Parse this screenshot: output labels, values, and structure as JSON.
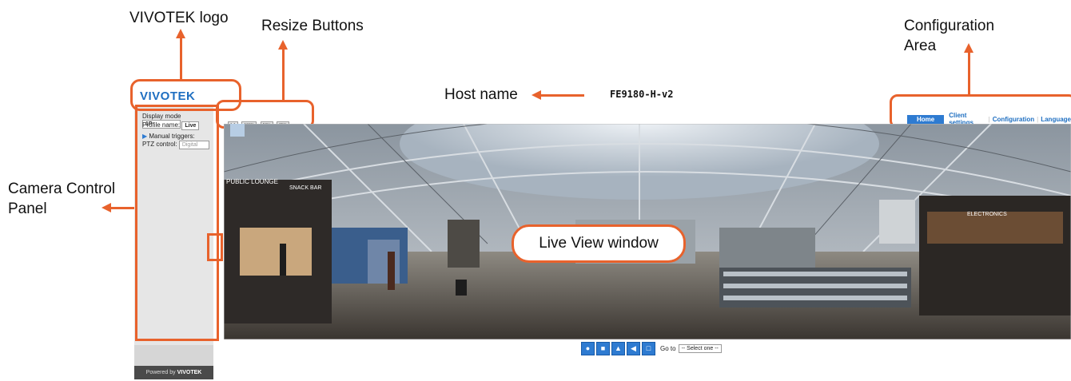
{
  "callouts": {
    "logo": "VIVOTEK logo",
    "resize": "Resize Buttons",
    "host": "Host name",
    "config_line1": "Configuration",
    "config_line2": "Area",
    "panel_line1": "Camera Control",
    "panel_line2": "Panel",
    "live": "Live View window"
  },
  "brand": {
    "logo": "VIVOTEK",
    "powered": "Powered by",
    "powered_brand": "VIVOTEK"
  },
  "host_name": "FE9180-H-v2",
  "nav": {
    "home": "Home",
    "client": "Client settings",
    "config": "Configuration",
    "language": "Language"
  },
  "panel": {
    "display_mode_label": "Display mode",
    "display_mode_value": "1P",
    "profile_label": "Profile name:",
    "profile_value": "Live",
    "manual_triggers": "Manual triggers:",
    "ptz_label": "PTZ control:",
    "ptz_value": "Digital"
  },
  "resize_buttons": [
    "1:1",
    "100%",
    "50%",
    "25%"
  ],
  "scene_signs": {
    "lounge": "PUBLIC LOUNGE",
    "snack": "SNACK BAR",
    "electronics": "ELECTRONICS"
  },
  "bottom_bar": {
    "goto_label": "Go to",
    "goto_value": "-- Select one --"
  },
  "colors": {
    "accent": "#e8622c",
    "brand": "#1f6fc1",
    "home_bg": "#2e7bd1"
  }
}
